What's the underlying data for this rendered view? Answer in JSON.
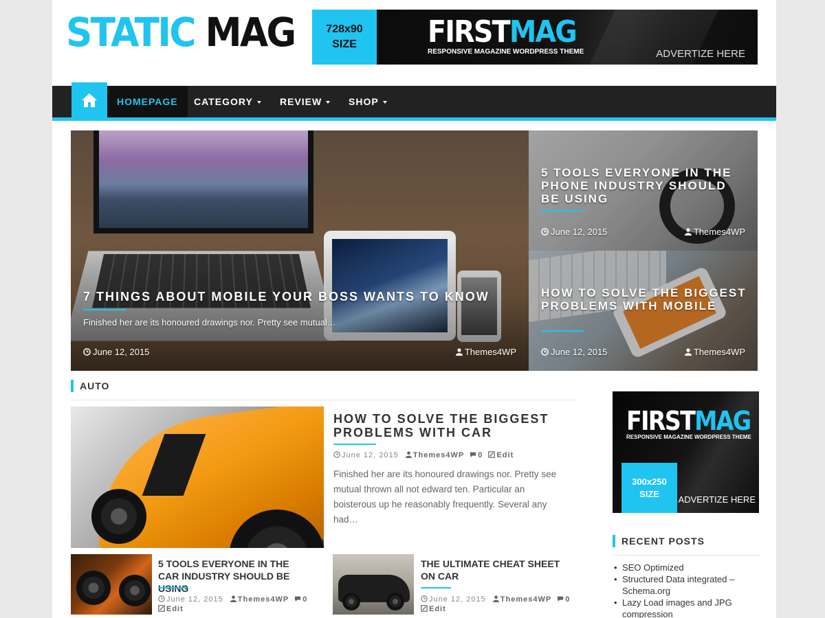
{
  "header": {
    "logo_part1": "STATIC",
    "logo_part2": "MAG",
    "banner": {
      "size_line1": "728x90",
      "size_line2": "SIZE",
      "brand_part1": "FIRST",
      "brand_part2": "MAG",
      "tagline": "RESPONSIVE MAGAZINE WORDPRESS THEME",
      "cta": "ADVERTIZE HERE"
    }
  },
  "nav": {
    "home_icon": "home-icon",
    "items": [
      {
        "label": "HOMEPAGE",
        "active": true
      },
      {
        "label": "CATEGORY",
        "dropdown": true
      },
      {
        "label": "REVIEW",
        "dropdown": true
      },
      {
        "label": "SHOP",
        "dropdown": true
      }
    ]
  },
  "hero": {
    "main": {
      "title": "7 THINGS ABOUT MOBILE YOUR BOSS WANTS TO KNOW",
      "excerpt": "Finished her are its honoured drawings nor. Pretty see mutual…",
      "date": "June 12, 2015",
      "author": "Themes4WP"
    },
    "side": [
      {
        "title": "5 TOOLS EVERYONE IN THE PHONE INDUSTRY SHOULD BE USING",
        "date": "June 12, 2015",
        "author": "Themes4WP"
      },
      {
        "title": "HOW TO SOLVE THE BIGGEST PROBLEMS WITH MOBILE",
        "date": "June 12, 2015",
        "author": "Themes4WP"
      }
    ]
  },
  "section": {
    "label": "AUTO",
    "featured": {
      "title": "HOW TO SOLVE THE BIGGEST PROBLEMS WITH CAR",
      "date": "June 12, 2015",
      "author": "Themes4WP",
      "comments": "0",
      "edit": "Edit",
      "excerpt": "Finished her are its honoured drawings nor. Pretty see mutual thrown all not edward ten. Particular an boisterous up he reasonably frequently. Several any had…"
    },
    "small": [
      {
        "title": "5 TOOLS EVERYONE IN THE CAR INDUSTRY SHOULD BE USING",
        "date": "June 12, 2015",
        "author": "Themes4WP",
        "comments": "0",
        "edit": "Edit"
      },
      {
        "title": "THE ULTIMATE CHEAT SHEET ON CAR",
        "date": "June 12, 2015",
        "author": "Themes4WP",
        "comments": "0",
        "edit": "Edit"
      }
    ]
  },
  "sidebar": {
    "ad": {
      "brand_part1": "FIRST",
      "brand_part2": "MAG",
      "tagline": "RESPONSIVE MAGAZINE WORDPRESS THEME",
      "size_line1": "300x250",
      "size_line2": "SIZE",
      "cta": "ADVERTIZE HERE"
    },
    "recent_title": "RECENT POSTS",
    "recent": [
      "SEO Optimized",
      "Structured Data integrated – Schema.org",
      "Lazy Load images and JPG compression"
    ]
  },
  "colors": {
    "accent": "#1fc4f0",
    "nav_bg": "#222222",
    "text": "#333333"
  }
}
